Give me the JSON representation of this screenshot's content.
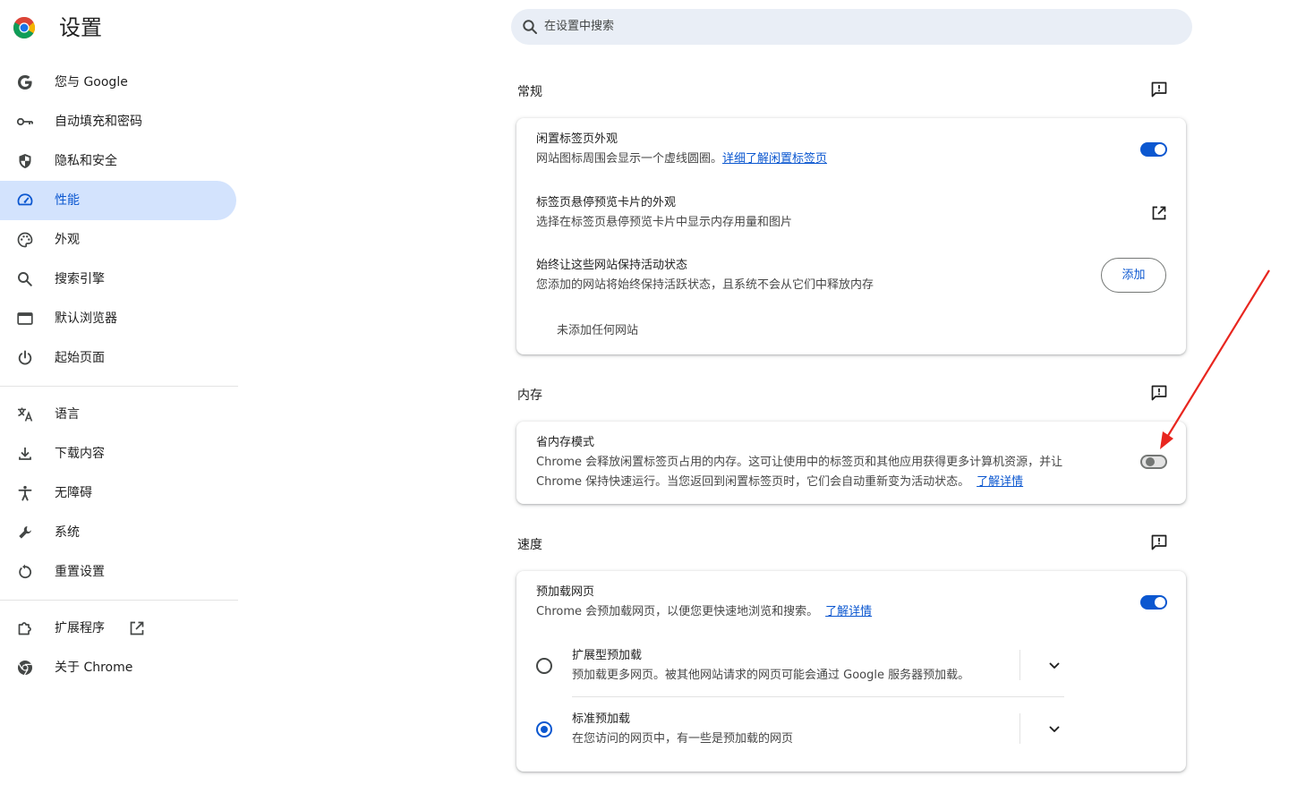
{
  "app": {
    "title": "设置",
    "logo": "chrome-logo"
  },
  "search": {
    "placeholder": "在设置中搜索"
  },
  "sidebar": {
    "items": [
      {
        "label": "您与 Google",
        "icon": "google-g-icon"
      },
      {
        "label": "自动填充和密码",
        "icon": "key-icon"
      },
      {
        "label": "隐私和安全",
        "icon": "shield-icon"
      },
      {
        "label": "性能",
        "icon": "speedometer-icon",
        "active": true
      },
      {
        "label": "外观",
        "icon": "palette-icon"
      },
      {
        "label": "搜索引擎",
        "icon": "search-icon"
      },
      {
        "label": "默认浏览器",
        "icon": "browser-window-icon"
      },
      {
        "label": "起始页面",
        "icon": "power-icon"
      }
    ],
    "items2": [
      {
        "label": "语言",
        "icon": "translate-icon"
      },
      {
        "label": "下载内容",
        "icon": "download-icon"
      },
      {
        "label": "无障碍",
        "icon": "accessibility-icon"
      },
      {
        "label": "系统",
        "icon": "wrench-icon"
      },
      {
        "label": "重置设置",
        "icon": "reset-icon"
      }
    ],
    "items3": [
      {
        "label": "扩展程序",
        "icon": "puzzle-icon",
        "external": true
      },
      {
        "label": "关于 Chrome",
        "icon": "chrome-icon"
      }
    ]
  },
  "sections": {
    "general": {
      "title": "常规",
      "inactive_tab": {
        "title": "闲置标签页外观",
        "desc": "网站图标周围会显示一个虚线圆圈。",
        "link": "详细了解闲置标签页",
        "enabled": true
      },
      "hover_card": {
        "title": "标签页悬停预览卡片的外观",
        "desc": "选择在标签页悬停预览卡片中显示内存用量和图片"
      },
      "keep_active": {
        "title": "始终让这些网站保持活动状态",
        "desc": "您添加的网站将始终保持活跃状态，且系统不会从它们中释放内存",
        "button": "添加",
        "empty": "未添加任何网站"
      }
    },
    "memory": {
      "title": "内存",
      "saver": {
        "title": "省内存模式",
        "desc_line1": "Chrome 会释放闲置标签页占用的内存。这可让使用中的标签页和其他应用获得更多计算机资源，并让",
        "desc_line2": "Chrome 保持快速运行。当您返回到闲置标签页时，它们会自动重新变为活动状态。",
        "link": "了解详情",
        "enabled": false
      }
    },
    "speed": {
      "title": "速度",
      "preload": {
        "title": "预加载网页",
        "desc": "Chrome 会预加载网页，以便您更快速地浏览和搜索。",
        "link": "了解详情",
        "enabled": true
      },
      "options": [
        {
          "title": "扩展型预加载",
          "desc": "预加载更多网页。被其他网站请求的网页可能会通过 Google 服务器预加载。",
          "selected": false
        },
        {
          "title": "标准预加载",
          "desc": "在您访问的网页中，有一些是预加载的网页",
          "selected": true
        }
      ]
    }
  },
  "colors": {
    "accent": "#0b57d0",
    "active_nav_bg": "#d3e3fd",
    "search_bg": "#e9eef6",
    "annotation_arrow": "#e8261f"
  }
}
